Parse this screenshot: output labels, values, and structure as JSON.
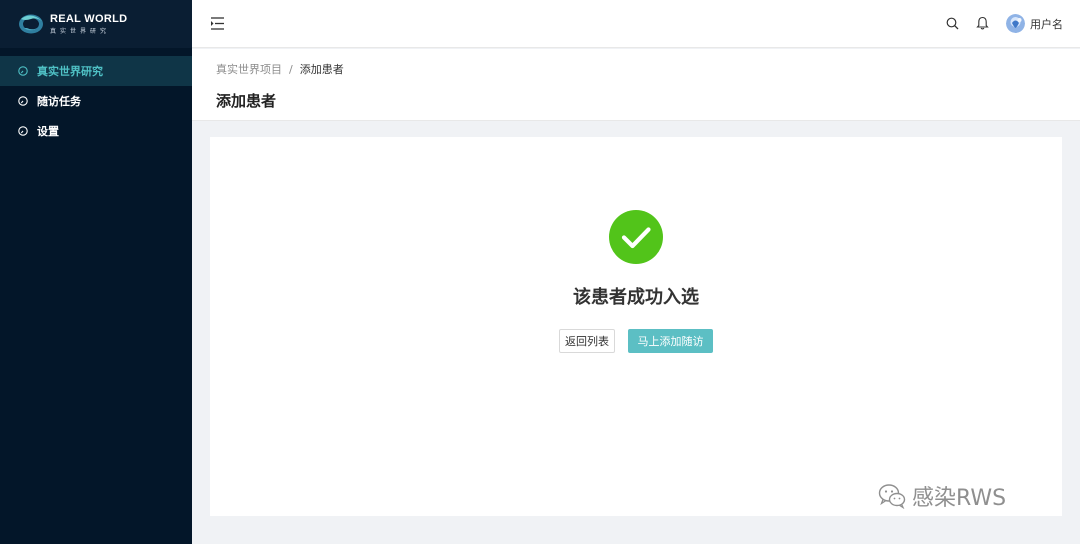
{
  "brand": {
    "title": "REAL WORLD",
    "subtitle": "真实世界研究"
  },
  "sidebar": {
    "items": [
      {
        "label": "真实世界研究",
        "active": true,
        "icon": "dashboard-icon"
      },
      {
        "label": "随访任务",
        "active": false,
        "icon": "dashboard-icon"
      },
      {
        "label": "设置",
        "active": false,
        "icon": "dashboard-icon"
      }
    ]
  },
  "header": {
    "username": "用户名",
    "icons": [
      "menu-fold-icon",
      "search-icon",
      "bell-icon",
      "avatar"
    ]
  },
  "breadcrumb": {
    "items": [
      "真实世界项目",
      "添加患者"
    ],
    "separator": "/"
  },
  "page": {
    "title": "添加患者"
  },
  "result": {
    "status": "success",
    "title": "该患者成功入选",
    "back_button": "返回列表",
    "primary_button": "马上添加随访"
  },
  "watermark": {
    "text": "感染RWS"
  },
  "colors": {
    "sidebar_bg": "#031629",
    "accent": "#4fc1c5",
    "primary_button": "#5cbfc4",
    "success": "#52c41a"
  }
}
